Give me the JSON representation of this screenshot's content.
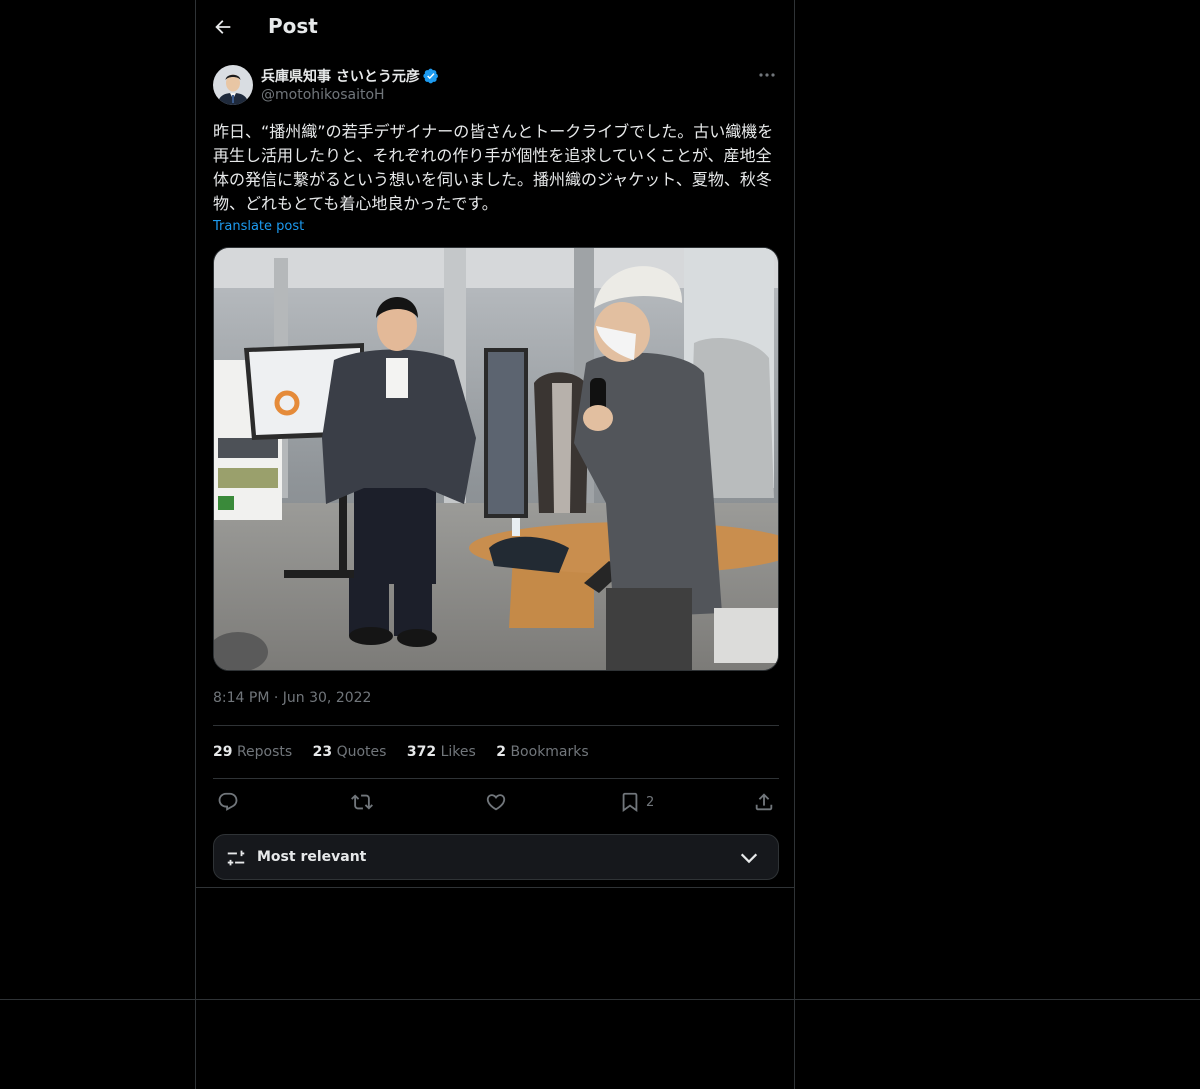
{
  "header": {
    "title": "Post"
  },
  "author": {
    "name": "兵庫県知事 さいとう元彦",
    "handle": "@motohikosaitoH",
    "verified": true
  },
  "post": {
    "text": "昨日、“播州織”の若手デザイナーの皆さんとトークライブでした。古い織機を再生し活用したりと、それぞれの作り手が個性を追求していくことが、産地全体の発信に繋がるという想いを伺いました。播州織のジャケット、夏物、秋冬物、どれもとても着心地良かったです。",
    "translate_label": "Translate post",
    "time": "8:14 PM",
    "separator": "·",
    "date": "Jun 30, 2022"
  },
  "stats": {
    "reposts": {
      "count": "29",
      "label": "Reposts"
    },
    "quotes": {
      "count": "23",
      "label": "Quotes"
    },
    "likes": {
      "count": "372",
      "label": "Likes"
    },
    "bookmarks": {
      "count": "2",
      "label": "Bookmarks"
    }
  },
  "actions": {
    "bookmark_count": "2"
  },
  "sort": {
    "label": "Most relevant"
  },
  "colors": {
    "background": "#000000",
    "text": "#e7e9ea",
    "muted": "#71767b",
    "accent": "#1d9bf0",
    "border": "#2f3336"
  }
}
